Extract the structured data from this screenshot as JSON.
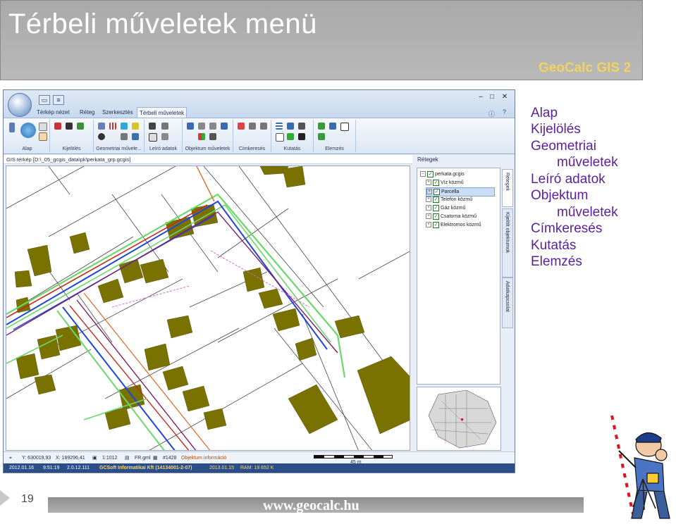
{
  "slide": {
    "title": "Térbeli műveletek menü",
    "brand": "GeoCalc GIS 2",
    "page_number": "19",
    "footer_url": "www.geocalc.hu"
  },
  "menu_items": [
    "Alap",
    "Kijelölés",
    "Geometriai",
    "műveletek",
    "Leíró adatok",
    "Objektum",
    "műveletek",
    "Címkeresés",
    "Kutatás",
    "Elemzés"
  ],
  "app": {
    "tabs": [
      "Térkép nézet",
      "Réteg",
      "Szerkesztés",
      "Térbeli műveletek"
    ],
    "window_controls": [
      "–",
      "□",
      "✕"
    ],
    "ribbon_groups": [
      "Alap",
      "Kijelölés",
      "Geometriai művele...",
      "Leíró adatok",
      "Objektum műveletek",
      "Címkeresés",
      "Kutatás",
      "Elemzés"
    ],
    "path": "GIS térkép [D:\\_05_gcgis_data\\pk\\perkata_grp.gcgis]",
    "layers_panel_title": "Rétegek",
    "layers_root": "perkata.gcgis",
    "layers": [
      "Víz közmű",
      "Parcella",
      "Telefon közmű",
      "Gáz közmű",
      "Csatorna közmű",
      "Elektromos közmű"
    ],
    "side_tabs": [
      "Rétegek",
      "Kijelölt objektumok",
      "Adatkapcsolat"
    ],
    "status": {
      "y": "Y: 630019,93",
      "x": "X: 189296,41",
      "scale": "1:1012",
      "file": "FR.gml",
      "object_id": "#1428",
      "object_info": "Objektum információ",
      "scalebar": "45 m"
    },
    "bottom": {
      "date": "2012.01.16",
      "time": "9:51:19",
      "version": "2.0.12.111",
      "company": "GCSoft Informatikai Kft (14134001-2-07)",
      "date2": "2013.01.15",
      "ram": "RAM: 19 652 K"
    }
  },
  "colors": {
    "menu_text": "#5b1f9a",
    "brand": "#f2d35c",
    "header_bg": "#b0b0b0",
    "building": "#7a7200",
    "water": "#6ad86a",
    "cable_blue": "#2046d8",
    "gas_red": "#c4291b"
  }
}
